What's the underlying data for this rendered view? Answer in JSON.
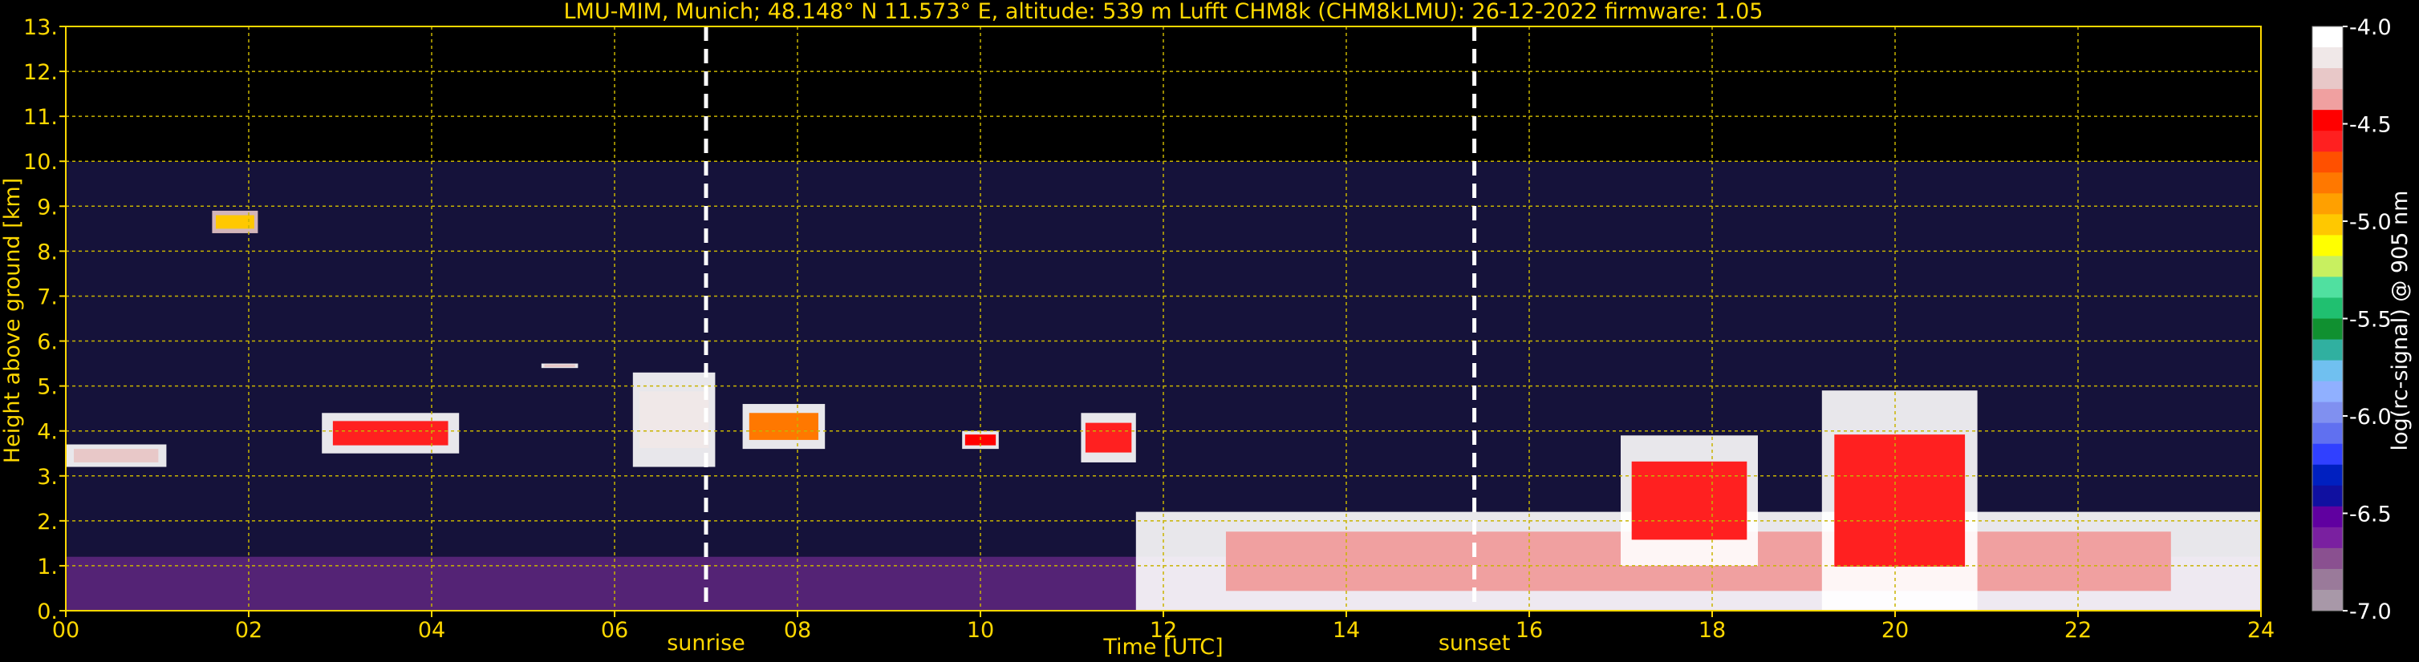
{
  "chart_data": {
    "type": "heatmap",
    "title": "LMU-MIM, Munich; 48.148° N 11.573° E, altitude: 539 m    Lufft CHM8k (CHM8kLMU): 26-12-2022    firmware: 1.05",
    "xlabel": "Time [UTC]",
    "ylabel": "Height above ground [km]",
    "xlim": [
      0,
      24
    ],
    "ylim": [
      0,
      13
    ],
    "x_ticks": [
      "00",
      "02",
      "04",
      "06",
      "08",
      "10",
      "12",
      "14",
      "16",
      "18",
      "20",
      "22",
      "24"
    ],
    "y_ticks": [
      "0.",
      "1.",
      "2.",
      "3.",
      "4.",
      "5.",
      "6.",
      "7.",
      "8.",
      "9.",
      "10.",
      "11.",
      "12.",
      "13."
    ],
    "grid": true,
    "data_top_km": 10,
    "annotations": [
      {
        "label": "sunrise",
        "x": 7.0
      },
      {
        "label": "sunset",
        "x": 15.4
      }
    ],
    "colorbar": {
      "label": "log(rc-signal) @ 905 nm",
      "range": [
        -7.0,
        -4.0
      ],
      "ticks": [
        "-4.0",
        "-4.5",
        "-5.0",
        "-5.5",
        "-6.0",
        "-6.5",
        "-7.0"
      ],
      "colors": [
        "#ffffff",
        "#f0e8e8",
        "#e8c8c8",
        "#f0a0a0",
        "#ff0000",
        "#ff2020",
        "#ff5000",
        "#ff7800",
        "#ffa000",
        "#ffc800",
        "#ffff00",
        "#c8f060",
        "#50e0a0",
        "#20c070",
        "#109030",
        "#30b0a0",
        "#70c0f0",
        "#90b0ff",
        "#8090f0",
        "#6070f0",
        "#3040ff",
        "#0020c0",
        "#1010a0",
        "#6000a0",
        "#7a20a0",
        "#8a5090",
        "#9a7a9a",
        "#a898a8"
      ]
    },
    "clouds": [
      {
        "t0": 0.0,
        "t1": 1.1,
        "z0": 3.2,
        "z1": 3.7,
        "intensity": -4.2
      },
      {
        "t0": 1.6,
        "t1": 2.1,
        "z0": 8.4,
        "z1": 8.9,
        "intensity": -5.0
      },
      {
        "t0": 2.8,
        "t1": 4.3,
        "z0": 3.5,
        "z1": 4.4,
        "intensity": -4.6
      },
      {
        "t0": 5.2,
        "t1": 5.6,
        "z0": 5.4,
        "z1": 5.5,
        "intensity": -4.2
      },
      {
        "t0": 6.2,
        "t1": 7.1,
        "z0": 3.2,
        "z1": 5.3,
        "intensity": -4.1
      },
      {
        "t0": 7.4,
        "t1": 8.3,
        "z0": 3.6,
        "z1": 4.6,
        "intensity": -4.8
      },
      {
        "t0": 9.8,
        "t1": 10.2,
        "z0": 3.6,
        "z1": 4.0,
        "intensity": -4.4
      },
      {
        "t0": 11.1,
        "t1": 11.7,
        "z0": 3.3,
        "z1": 4.4,
        "intensity": -4.5
      },
      {
        "t0": 11.7,
        "t1": 24.0,
        "z0": 0.0,
        "z1": 2.2,
        "intensity": -4.3
      },
      {
        "t0": 17.0,
        "t1": 18.5,
        "z0": 1.0,
        "z1": 3.9,
        "intensity": -4.6
      },
      {
        "t0": 19.2,
        "t1": 20.9,
        "z0": 0.0,
        "z1": 4.9,
        "intensity": -4.6
      }
    ]
  }
}
